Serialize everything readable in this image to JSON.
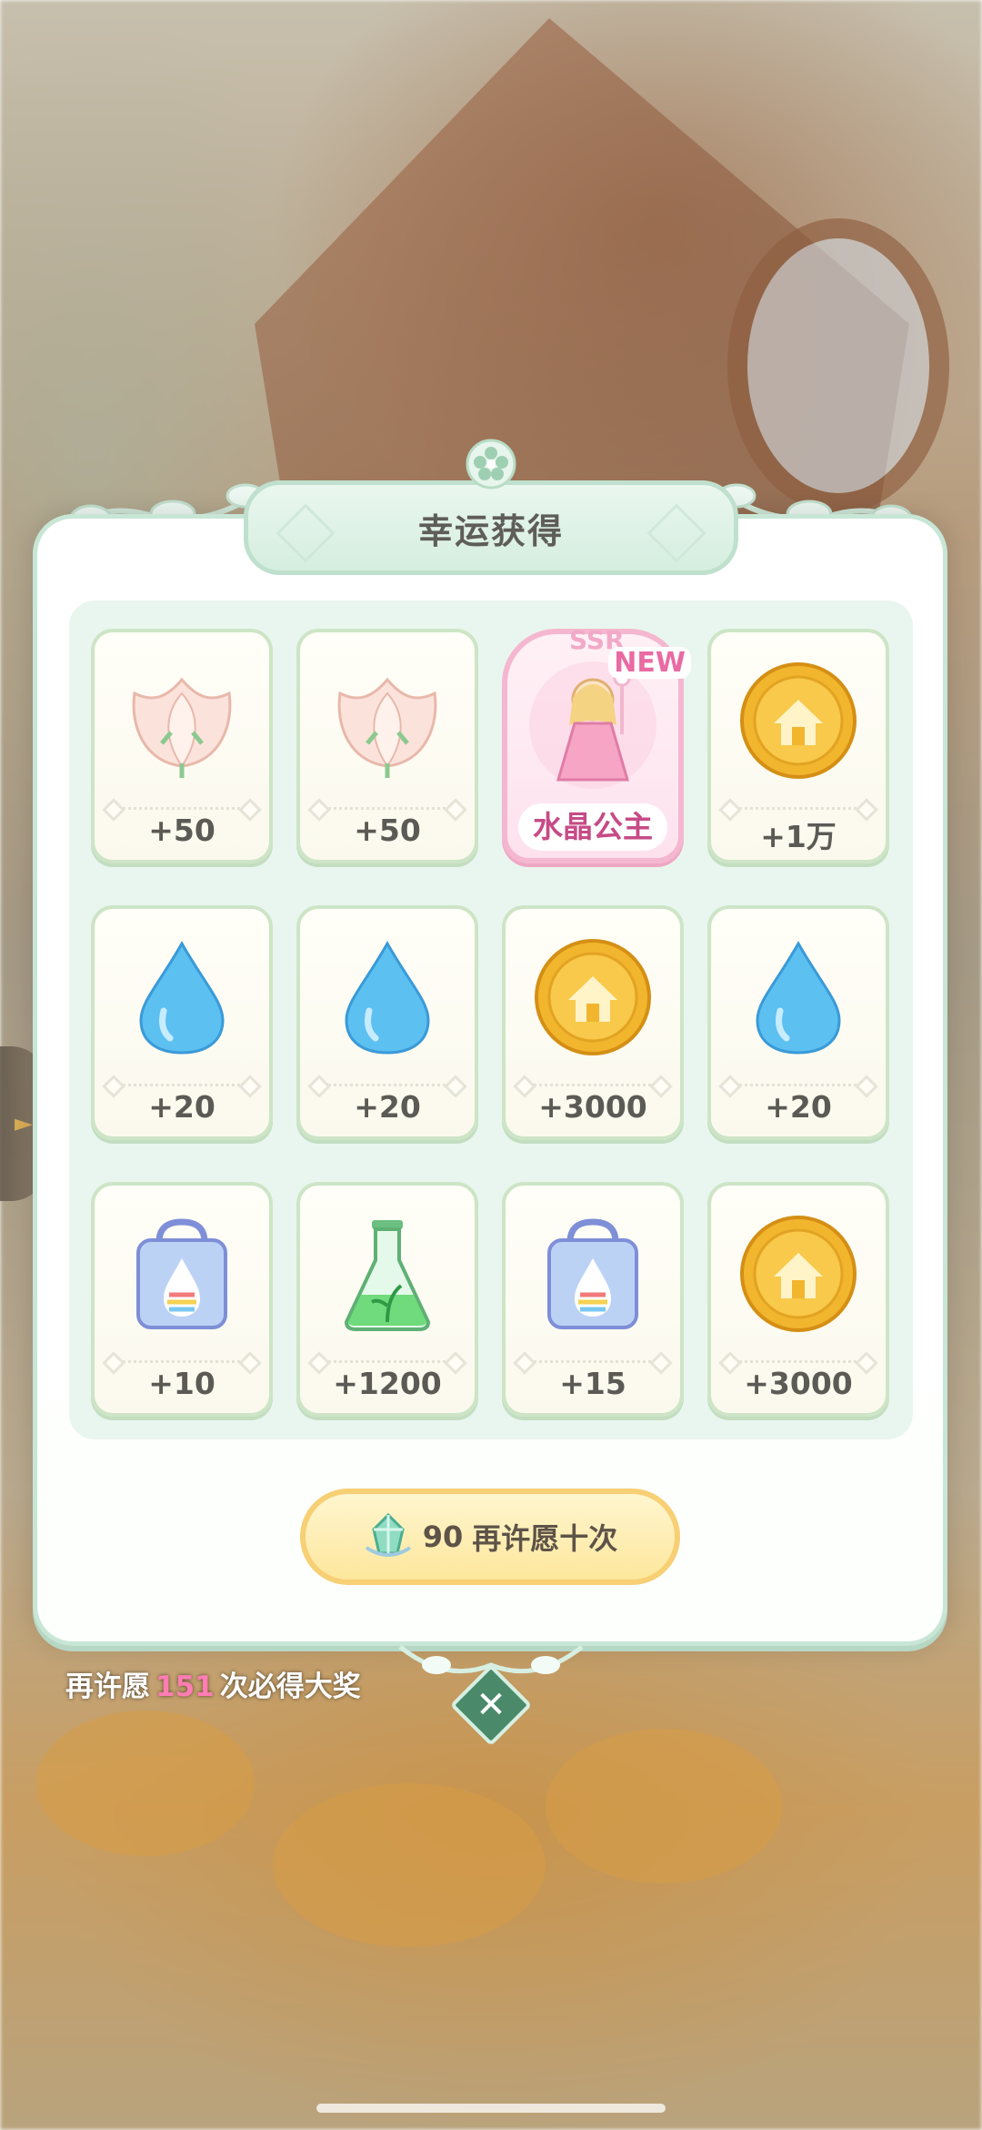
{
  "dialog": {
    "title": "幸运获得",
    "rewards": [
      {
        "amount": "+50",
        "icon": "pink-flower-icon"
      },
      {
        "amount": "+50",
        "icon": "pink-flower-icon"
      },
      {
        "amount": "",
        "icon": "crystal-princess-card",
        "rarity": "SSR",
        "badge": "NEW",
        "name": "水晶公主"
      },
      {
        "amount": "+1万",
        "icon": "gold-coin-icon"
      },
      {
        "amount": "+20",
        "icon": "water-drop-icon"
      },
      {
        "amount": "+20",
        "icon": "water-drop-icon"
      },
      {
        "amount": "+3000",
        "icon": "gold-coin-icon"
      },
      {
        "amount": "+20",
        "icon": "water-drop-icon"
      },
      {
        "amount": "+10",
        "icon": "rainbow-drop-box-icon"
      },
      {
        "amount": "+1200",
        "icon": "green-potion-flask-icon"
      },
      {
        "amount": "+15",
        "icon": "rainbow-drop-box-icon"
      },
      {
        "amount": "+3000",
        "icon": "gold-coin-icon"
      }
    ],
    "repeat_button": {
      "cost": "90",
      "label": "再许愿十次",
      "icon": "green-crystal-icon"
    },
    "guarantee": {
      "prefix": "再许愿",
      "count": "151",
      "suffix": "次必得大奖"
    },
    "close_icon": "close-icon"
  },
  "colors": {
    "panel_border": "#c8e6d6",
    "ssr_pink": "#c64b86",
    "guarantee_count": "#ff7db2",
    "button_gold": "#f7cf74"
  }
}
